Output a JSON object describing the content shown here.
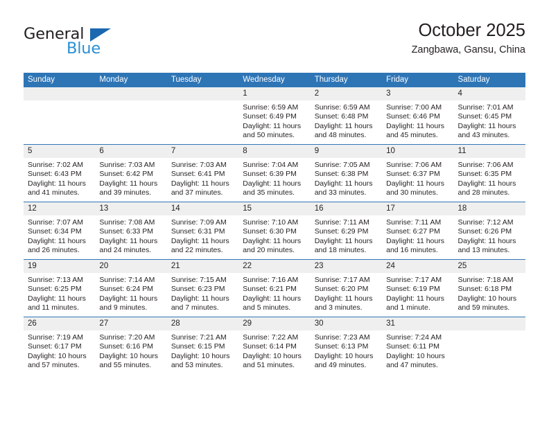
{
  "brand": {
    "name_top": "General",
    "name_bottom": "Blue",
    "triangle_color": "#1b67b0",
    "blue_text_color": "#2a8fd4"
  },
  "header": {
    "title": "October 2025",
    "location": "Zangbawa, Gansu, China"
  },
  "theme": {
    "header_bg": "#2e75b6",
    "daynum_bg": "#efefef",
    "cell_bg": "#ffffff",
    "text_color": "#231f20"
  },
  "weekdays": [
    "Sunday",
    "Monday",
    "Tuesday",
    "Wednesday",
    "Thursday",
    "Friday",
    "Saturday"
  ],
  "weeks": [
    [
      {
        "day": "",
        "sunrise": "",
        "sunset": "",
        "daylight1": "",
        "daylight2": ""
      },
      {
        "day": "",
        "sunrise": "",
        "sunset": "",
        "daylight1": "",
        "daylight2": ""
      },
      {
        "day": "",
        "sunrise": "",
        "sunset": "",
        "daylight1": "",
        "daylight2": ""
      },
      {
        "day": "1",
        "sunrise": "Sunrise: 6:59 AM",
        "sunset": "Sunset: 6:49 PM",
        "daylight1": "Daylight: 11 hours",
        "daylight2": "and 50 minutes."
      },
      {
        "day": "2",
        "sunrise": "Sunrise: 6:59 AM",
        "sunset": "Sunset: 6:48 PM",
        "daylight1": "Daylight: 11 hours",
        "daylight2": "and 48 minutes."
      },
      {
        "day": "3",
        "sunrise": "Sunrise: 7:00 AM",
        "sunset": "Sunset: 6:46 PM",
        "daylight1": "Daylight: 11 hours",
        "daylight2": "and 45 minutes."
      },
      {
        "day": "4",
        "sunrise": "Sunrise: 7:01 AM",
        "sunset": "Sunset: 6:45 PM",
        "daylight1": "Daylight: 11 hours",
        "daylight2": "and 43 minutes."
      }
    ],
    [
      {
        "day": "5",
        "sunrise": "Sunrise: 7:02 AM",
        "sunset": "Sunset: 6:43 PM",
        "daylight1": "Daylight: 11 hours",
        "daylight2": "and 41 minutes."
      },
      {
        "day": "6",
        "sunrise": "Sunrise: 7:03 AM",
        "sunset": "Sunset: 6:42 PM",
        "daylight1": "Daylight: 11 hours",
        "daylight2": "and 39 minutes."
      },
      {
        "day": "7",
        "sunrise": "Sunrise: 7:03 AM",
        "sunset": "Sunset: 6:41 PM",
        "daylight1": "Daylight: 11 hours",
        "daylight2": "and 37 minutes."
      },
      {
        "day": "8",
        "sunrise": "Sunrise: 7:04 AM",
        "sunset": "Sunset: 6:39 PM",
        "daylight1": "Daylight: 11 hours",
        "daylight2": "and 35 minutes."
      },
      {
        "day": "9",
        "sunrise": "Sunrise: 7:05 AM",
        "sunset": "Sunset: 6:38 PM",
        "daylight1": "Daylight: 11 hours",
        "daylight2": "and 33 minutes."
      },
      {
        "day": "10",
        "sunrise": "Sunrise: 7:06 AM",
        "sunset": "Sunset: 6:37 PM",
        "daylight1": "Daylight: 11 hours",
        "daylight2": "and 30 minutes."
      },
      {
        "day": "11",
        "sunrise": "Sunrise: 7:06 AM",
        "sunset": "Sunset: 6:35 PM",
        "daylight1": "Daylight: 11 hours",
        "daylight2": "and 28 minutes."
      }
    ],
    [
      {
        "day": "12",
        "sunrise": "Sunrise: 7:07 AM",
        "sunset": "Sunset: 6:34 PM",
        "daylight1": "Daylight: 11 hours",
        "daylight2": "and 26 minutes."
      },
      {
        "day": "13",
        "sunrise": "Sunrise: 7:08 AM",
        "sunset": "Sunset: 6:33 PM",
        "daylight1": "Daylight: 11 hours",
        "daylight2": "and 24 minutes."
      },
      {
        "day": "14",
        "sunrise": "Sunrise: 7:09 AM",
        "sunset": "Sunset: 6:31 PM",
        "daylight1": "Daylight: 11 hours",
        "daylight2": "and 22 minutes."
      },
      {
        "day": "15",
        "sunrise": "Sunrise: 7:10 AM",
        "sunset": "Sunset: 6:30 PM",
        "daylight1": "Daylight: 11 hours",
        "daylight2": "and 20 minutes."
      },
      {
        "day": "16",
        "sunrise": "Sunrise: 7:11 AM",
        "sunset": "Sunset: 6:29 PM",
        "daylight1": "Daylight: 11 hours",
        "daylight2": "and 18 minutes."
      },
      {
        "day": "17",
        "sunrise": "Sunrise: 7:11 AM",
        "sunset": "Sunset: 6:27 PM",
        "daylight1": "Daylight: 11 hours",
        "daylight2": "and 16 minutes."
      },
      {
        "day": "18",
        "sunrise": "Sunrise: 7:12 AM",
        "sunset": "Sunset: 6:26 PM",
        "daylight1": "Daylight: 11 hours",
        "daylight2": "and 13 minutes."
      }
    ],
    [
      {
        "day": "19",
        "sunrise": "Sunrise: 7:13 AM",
        "sunset": "Sunset: 6:25 PM",
        "daylight1": "Daylight: 11 hours",
        "daylight2": "and 11 minutes."
      },
      {
        "day": "20",
        "sunrise": "Sunrise: 7:14 AM",
        "sunset": "Sunset: 6:24 PM",
        "daylight1": "Daylight: 11 hours",
        "daylight2": "and 9 minutes."
      },
      {
        "day": "21",
        "sunrise": "Sunrise: 7:15 AM",
        "sunset": "Sunset: 6:23 PM",
        "daylight1": "Daylight: 11 hours",
        "daylight2": "and 7 minutes."
      },
      {
        "day": "22",
        "sunrise": "Sunrise: 7:16 AM",
        "sunset": "Sunset: 6:21 PM",
        "daylight1": "Daylight: 11 hours",
        "daylight2": "and 5 minutes."
      },
      {
        "day": "23",
        "sunrise": "Sunrise: 7:17 AM",
        "sunset": "Sunset: 6:20 PM",
        "daylight1": "Daylight: 11 hours",
        "daylight2": "and 3 minutes."
      },
      {
        "day": "24",
        "sunrise": "Sunrise: 7:17 AM",
        "sunset": "Sunset: 6:19 PM",
        "daylight1": "Daylight: 11 hours",
        "daylight2": "and 1 minute."
      },
      {
        "day": "25",
        "sunrise": "Sunrise: 7:18 AM",
        "sunset": "Sunset: 6:18 PM",
        "daylight1": "Daylight: 10 hours",
        "daylight2": "and 59 minutes."
      }
    ],
    [
      {
        "day": "26",
        "sunrise": "Sunrise: 7:19 AM",
        "sunset": "Sunset: 6:17 PM",
        "daylight1": "Daylight: 10 hours",
        "daylight2": "and 57 minutes."
      },
      {
        "day": "27",
        "sunrise": "Sunrise: 7:20 AM",
        "sunset": "Sunset: 6:16 PM",
        "daylight1": "Daylight: 10 hours",
        "daylight2": "and 55 minutes."
      },
      {
        "day": "28",
        "sunrise": "Sunrise: 7:21 AM",
        "sunset": "Sunset: 6:15 PM",
        "daylight1": "Daylight: 10 hours",
        "daylight2": "and 53 minutes."
      },
      {
        "day": "29",
        "sunrise": "Sunrise: 7:22 AM",
        "sunset": "Sunset: 6:14 PM",
        "daylight1": "Daylight: 10 hours",
        "daylight2": "and 51 minutes."
      },
      {
        "day": "30",
        "sunrise": "Sunrise: 7:23 AM",
        "sunset": "Sunset: 6:13 PM",
        "daylight1": "Daylight: 10 hours",
        "daylight2": "and 49 minutes."
      },
      {
        "day": "31",
        "sunrise": "Sunrise: 7:24 AM",
        "sunset": "Sunset: 6:11 PM",
        "daylight1": "Daylight: 10 hours",
        "daylight2": "and 47 minutes."
      },
      {
        "day": "",
        "sunrise": "",
        "sunset": "",
        "daylight1": "",
        "daylight2": ""
      }
    ]
  ]
}
